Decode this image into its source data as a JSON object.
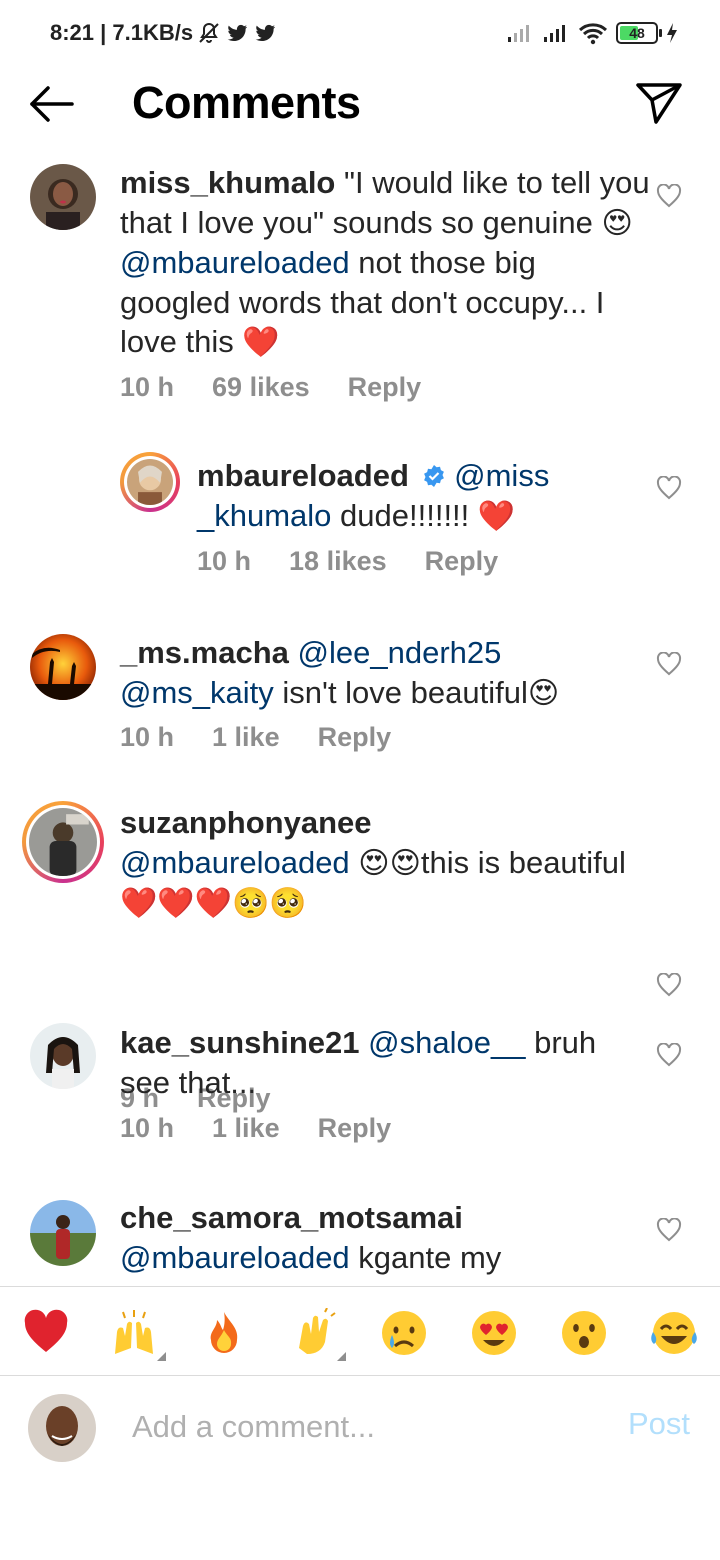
{
  "status_bar": {
    "time_speed": "8:21 | 7.1KB/s",
    "battery": "48"
  },
  "header": {
    "title": "Comments"
  },
  "comments": [
    {
      "username": "miss_khumalo",
      "text_1": " \"I would like to tell you that I love you\" sounds so genuine ",
      "emoji_1": "😍",
      "mention": "@mbaureloaded",
      "text_2": " not those big googled words that don't occupy... I love this ",
      "emoji_2": "❤️",
      "time": "10 h",
      "likes": "69 likes",
      "reply": "Reply"
    },
    {
      "username": "mbaureloaded",
      "mention": "@miss _khumalo",
      "text_1": " dude!!!!!!! ",
      "emoji_1": "❤️",
      "time": "10 h",
      "likes": "18 likes",
      "reply": "Reply"
    },
    {
      "username": "_ms.macha",
      "mention_1": "@lee_nderh25",
      "mention_2": "@ms_kaity",
      "text_1": "  isn't love beautiful",
      "emoji_1": "😍",
      "time": "10 h",
      "likes": "1 like",
      "reply": "Reply"
    },
    {
      "username": "suzanphonyanee",
      "mention": "@mbaureloaded",
      "emoji_1": "😍😍",
      "text_1": "this is beautiful",
      "emoji_2": "❤️❤️❤️🥺🥺",
      "time": "9 h",
      "reply": "Reply"
    },
    {
      "username": "kae_sunshine21",
      "mention": "@shaloe__",
      "text_1": " bruh see that...",
      "time": "10 h",
      "likes": "1 like",
      "reply": "Reply"
    },
    {
      "username": "che_samora_motsamai",
      "mention": "@mbaureloaded",
      "text_1": " kgante my"
    }
  ],
  "emoji_bar": [
    "heart",
    "raising-hands",
    "fire",
    "clapping-hands",
    "crying-face",
    "heart-eyes-face",
    "surprised-face",
    "tears-of-joy-face"
  ],
  "composer": {
    "placeholder": "Add a comment...",
    "post_label": "Post"
  }
}
